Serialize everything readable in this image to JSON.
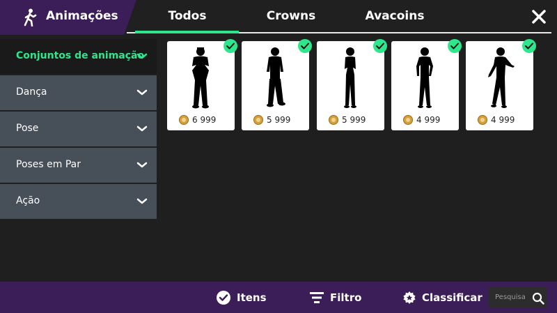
{
  "header": {
    "section_title": "Animações",
    "section_icon": "walking-person-icon",
    "tabs": [
      {
        "label": "Todos",
        "active": true
      },
      {
        "label": "Crowns",
        "active": false
      },
      {
        "label": "Avacoins",
        "active": false
      }
    ],
    "close_icon": "close-icon"
  },
  "sidebar": {
    "items": [
      {
        "label": "Conjuntos de animação",
        "active": true
      },
      {
        "label": "Dança",
        "active": false
      },
      {
        "label": "Pose",
        "active": false
      },
      {
        "label": "Poses em Par",
        "active": false
      },
      {
        "label": "Ação",
        "active": false
      }
    ]
  },
  "grid": {
    "items": [
      {
        "price": "6 999",
        "owned": true,
        "currency_icon": "avacoin-icon"
      },
      {
        "price": "5 999",
        "owned": true,
        "currency_icon": "avacoin-icon"
      },
      {
        "price": "5 999",
        "owned": true,
        "currency_icon": "avacoin-icon"
      },
      {
        "price": "4 999",
        "owned": true,
        "currency_icon": "avacoin-icon"
      },
      {
        "price": "4 999",
        "owned": true,
        "currency_icon": "avacoin-icon"
      }
    ]
  },
  "bottom_bar": {
    "items_label": "Itens",
    "filter_label": "Filtro",
    "sort_label": "Classificar",
    "search_placeholder": "Pesquisa"
  },
  "colors": {
    "accent": "#2ee68c",
    "purple": "#3b1d57",
    "sidebar_bg": "#474f58",
    "background": "#1f1f1f"
  }
}
